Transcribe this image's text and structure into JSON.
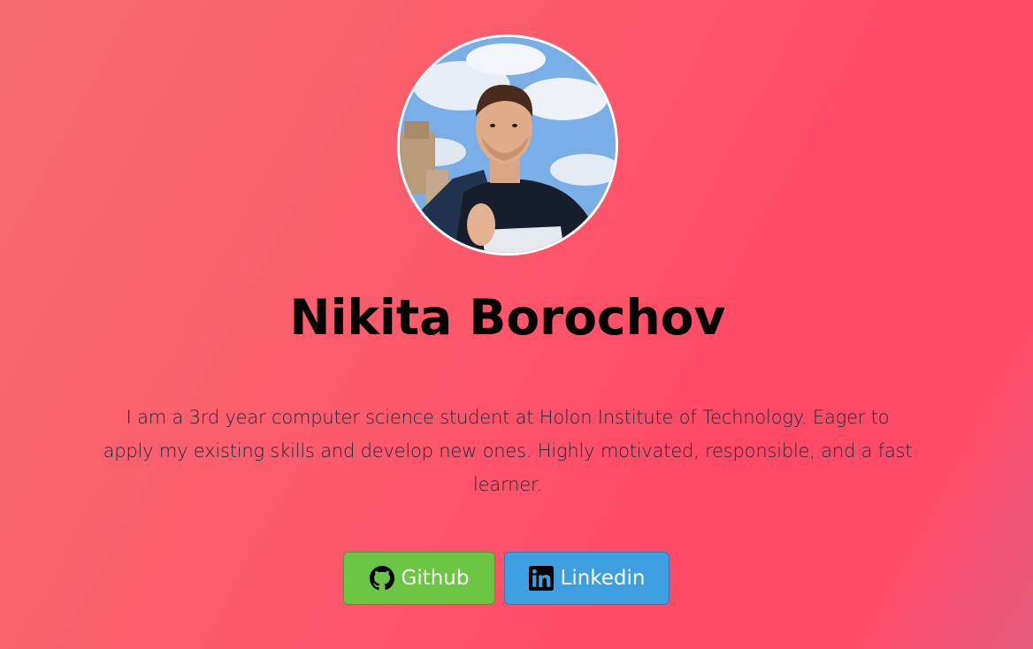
{
  "profile": {
    "name": "Nikita Borochov",
    "bio": "I am a 3rd year computer science student at Holon Institute of Technology. Eager to apply my existing skills and develop new ones. Highly motivated, responsible, and a fast learner.",
    "avatar_icon": "profile-photo"
  },
  "links": {
    "github": {
      "label": "Github",
      "icon": "github-icon",
      "color": "#6cc644"
    },
    "linkedin": {
      "label": "Linkedin",
      "icon": "linkedin-icon",
      "color": "#3d9ee0"
    }
  },
  "theme": {
    "background_start": "#f76b70",
    "background_end": "#ff4a66"
  }
}
